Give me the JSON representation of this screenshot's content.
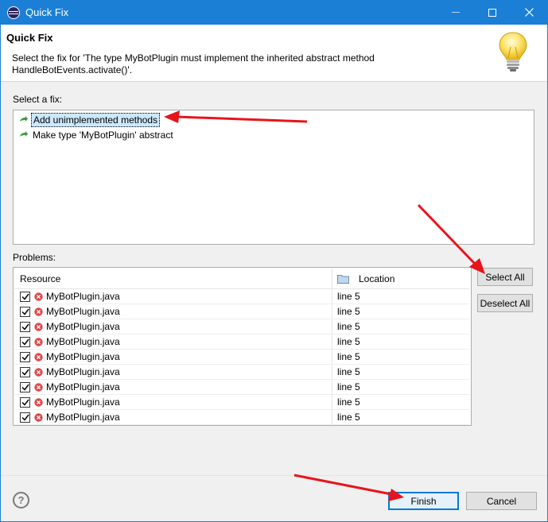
{
  "window": {
    "title": "Quick Fix",
    "minimize_glyph": "—",
    "maximize_glyph": "☐",
    "close_glyph": "✕"
  },
  "header": {
    "title": "Quick Fix",
    "message": "Select the fix for 'The type MyBotPlugin must implement the inherited abstract method HandleBotEvents.activate()'."
  },
  "fixes": {
    "label": "Select a fix:",
    "items": [
      {
        "label": "Add unimplemented methods",
        "selected": true
      },
      {
        "label": "Make type 'MyBotPlugin' abstract",
        "selected": false
      }
    ]
  },
  "problems": {
    "label": "Problems:",
    "columns": {
      "resource": "Resource",
      "location": "Location"
    },
    "rows": [
      {
        "resource": "MyBotPlugin.java",
        "location": "line 5",
        "checked": true
      },
      {
        "resource": "MyBotPlugin.java",
        "location": "line 5",
        "checked": true
      },
      {
        "resource": "MyBotPlugin.java",
        "location": "line 5",
        "checked": true
      },
      {
        "resource": "MyBotPlugin.java",
        "location": "line 5",
        "checked": true
      },
      {
        "resource": "MyBotPlugin.java",
        "location": "line 5",
        "checked": true
      },
      {
        "resource": "MyBotPlugin.java",
        "location": "line 5",
        "checked": true
      },
      {
        "resource": "MyBotPlugin.java",
        "location": "line 5",
        "checked": true
      },
      {
        "resource": "MyBotPlugin.java",
        "location": "line 5",
        "checked": true
      },
      {
        "resource": "MyBotPlugin.java",
        "location": "line 5",
        "checked": true
      }
    ]
  },
  "buttons": {
    "select_all": "Select All",
    "deselect_all": "Deselect All",
    "finish": "Finish",
    "cancel": "Cancel",
    "help": "?"
  },
  "colors": {
    "titlebar": "#1c7fd6",
    "annotation_arrow": "#e8141b",
    "error_icon": "#e0484b",
    "fix_icon": "#3f9b3f"
  }
}
